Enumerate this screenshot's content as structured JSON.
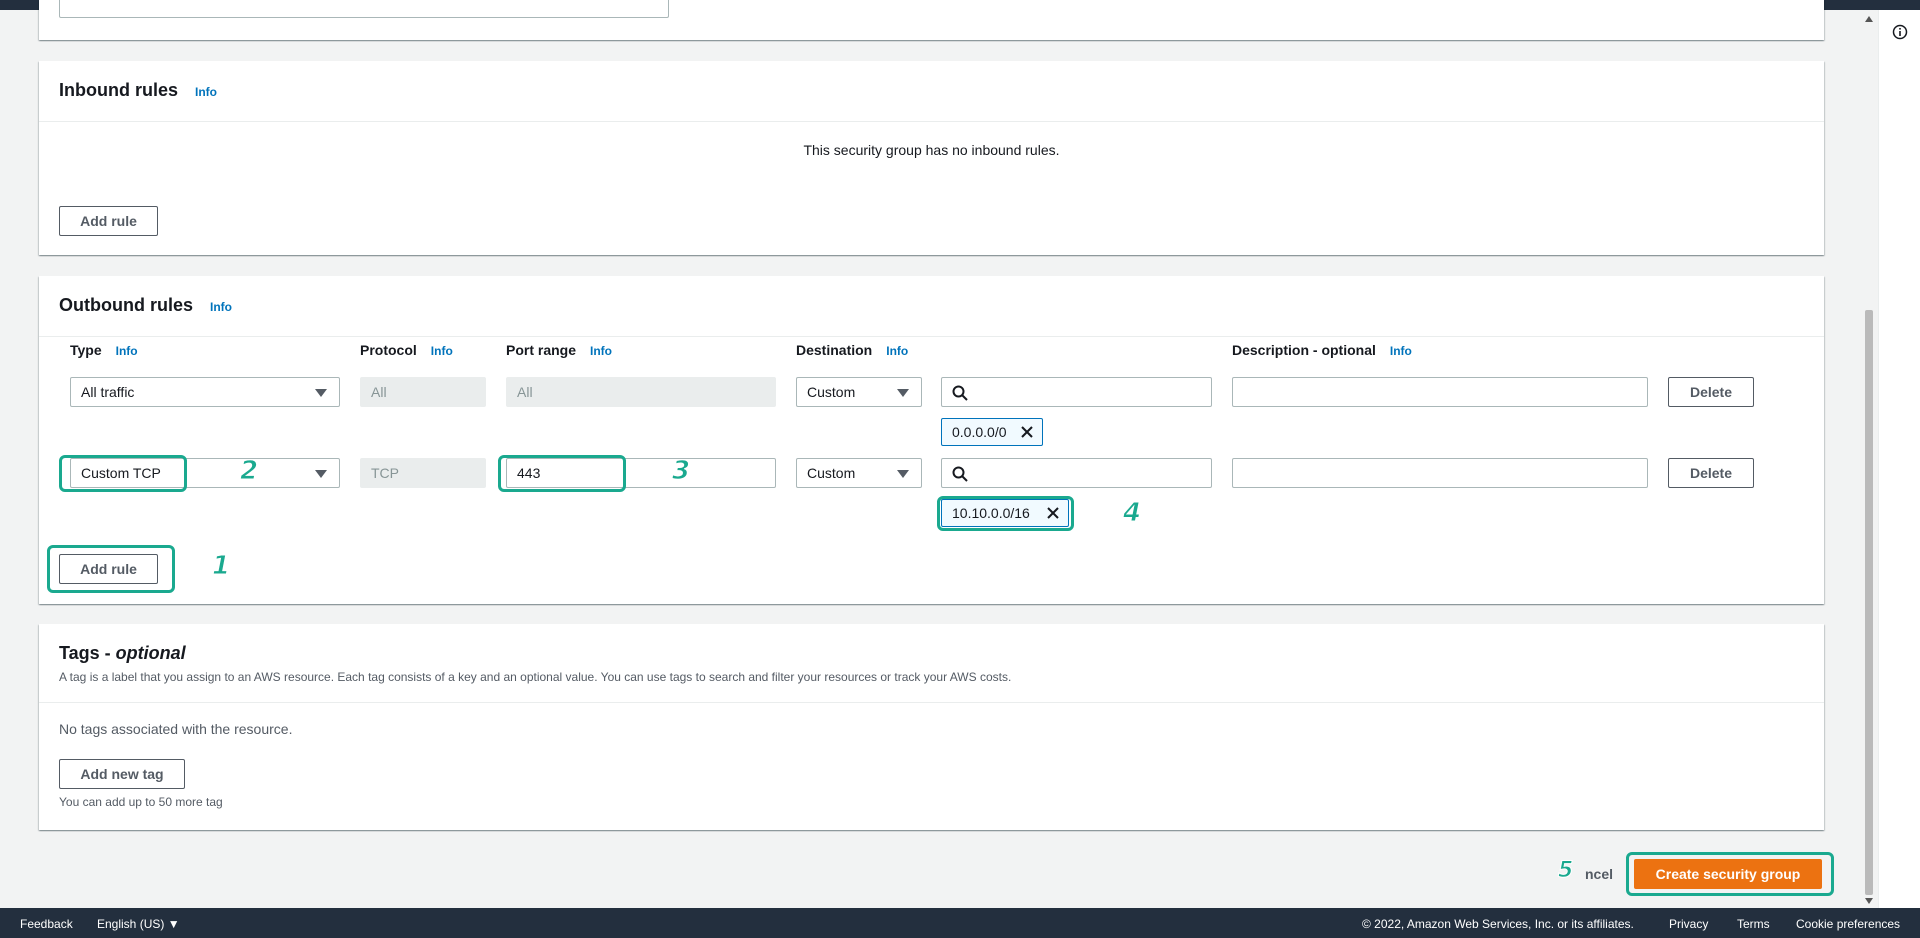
{
  "inbound": {
    "title": "Inbound rules",
    "info": "Info",
    "empty_message": "This security group has no inbound rules.",
    "add_rule": "Add rule"
  },
  "outbound": {
    "title": "Outbound rules",
    "info": "Info",
    "columns": {
      "type": "Type",
      "protocol": "Protocol",
      "port_range": "Port range",
      "destination": "Destination",
      "description": "Description - optional",
      "info": "Info"
    },
    "rows": [
      {
        "type": "All traffic",
        "protocol": "All",
        "port_range": "All",
        "destination": "Custom",
        "token": "0.0.0.0/0",
        "delete": "Delete"
      },
      {
        "type": "Custom TCP",
        "protocol": "TCP",
        "port_range": "443",
        "destination": "Custom",
        "token": "10.10.0.0/16",
        "delete": "Delete"
      }
    ],
    "add_rule": "Add rule"
  },
  "tags": {
    "title_main": "Tags - ",
    "title_italic": "optional",
    "description": "A tag is a label that you assign to an AWS resource. Each tag consists of a key and an optional value. You can use tags to search and filter your resources or track your AWS costs.",
    "empty_message": "No tags associated with the resource.",
    "add_tag": "Add new tag",
    "limit_note": "You can add up to 50 more tag"
  },
  "actions": {
    "cancel": "Cancel",
    "cancel_visible": "ncel",
    "create": "Create security group"
  },
  "callouts": [
    "1",
    "2",
    "3",
    "4",
    "5"
  ],
  "footer": {
    "feedback": "Feedback",
    "language": "English (US) ▼",
    "copyright": "© 2022, Amazon Web Services, Inc. or its affiliates.",
    "privacy": "Privacy",
    "terms": "Terms",
    "cookie": "Cookie preferences"
  },
  "colors": {
    "accent": "#ec7211",
    "link": "#0073bb",
    "callout": "#1aa98f",
    "footer_bg": "#232f3e"
  }
}
